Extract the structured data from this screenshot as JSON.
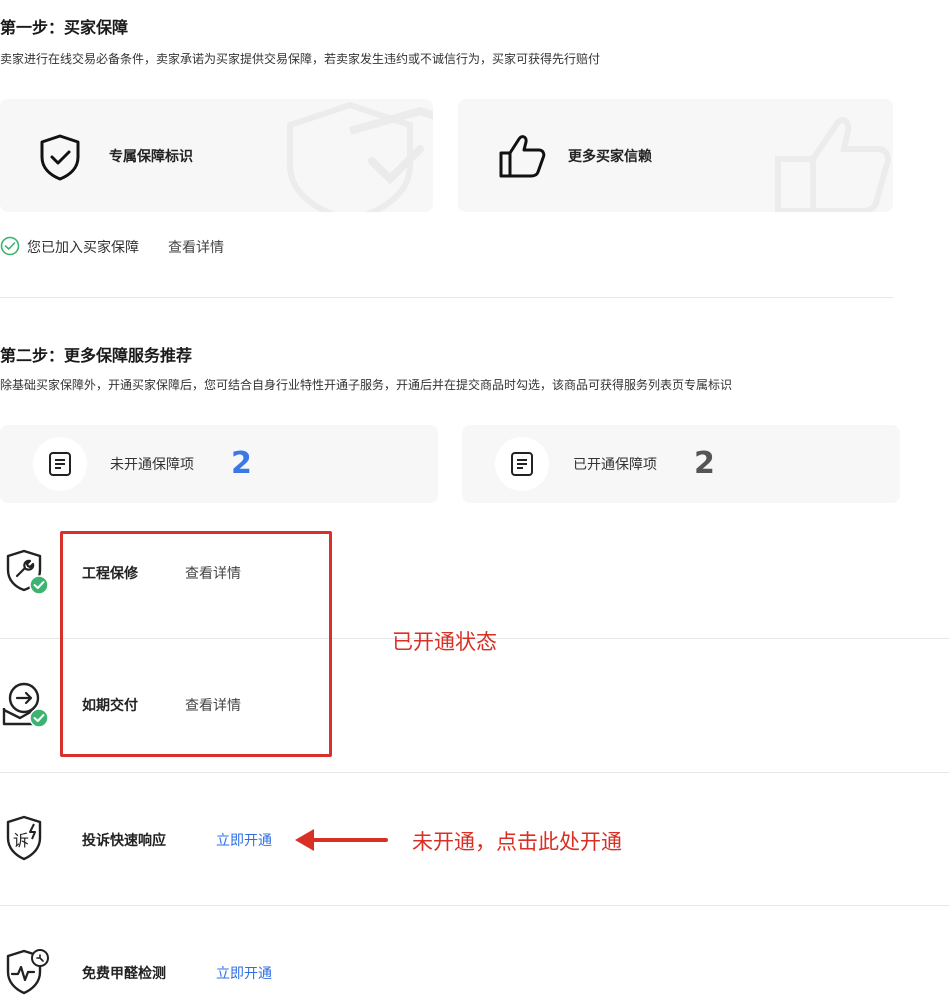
{
  "step1": {
    "title": "第一步：买家保障",
    "description": "卖家进行在线交易必备条件，卖家承诺为买家提供交易保障，若卖家发生违约或不诚信行为，买家可获得先行赔付",
    "cards": [
      {
        "label": "专属保障标识",
        "icon": "shield-check-icon"
      },
      {
        "label": "更多买家信赖",
        "icon": "thumbs-up-icon"
      }
    ],
    "status_text": "您已加入买家保障",
    "detail_link": "查看详情"
  },
  "step2": {
    "title": "第二步：更多保障服务推荐",
    "description": "除基础买家保障外，开通买家保障后，您可结合自身行业特性开通子服务，开通后并在提交商品时勾选，该商品可获得服务列表页专属标识",
    "stats": [
      {
        "label": "未开通保障项",
        "count": "2",
        "color": "#3a78e8"
      },
      {
        "label": "已开通保障项",
        "count": "2",
        "color": "#555555"
      }
    ]
  },
  "services": [
    {
      "name": "工程保修",
      "action": "查看详情",
      "icon": "wrench-shield-icon"
    },
    {
      "name": "如期交付",
      "action": "查看详情",
      "icon": "delivery-envelope-icon"
    },
    {
      "name": "投诉快速响应",
      "action": "立即开通",
      "icon": "complaint-shield-icon"
    },
    {
      "name": "免费甲醛检测",
      "action": "立即开通",
      "icon": "formaldehyde-shield-icon"
    }
  ],
  "annotations": {
    "enabled_state": "已开通状态",
    "not_enabled_hint": "未开通，点击此处开通"
  },
  "colors": {
    "accent_blue": "#2f6fe4",
    "success_green": "#3cb371",
    "annotation_red": "#d93025"
  }
}
